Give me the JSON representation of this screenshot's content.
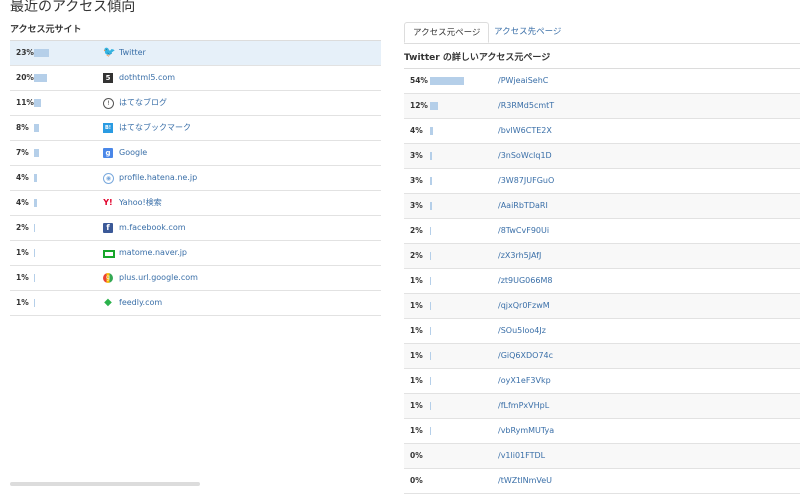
{
  "page_title": "最近のアクセス傾向",
  "sites_section": {
    "heading": "アクセス元サイト",
    "rows": [
      {
        "pct": "23%",
        "value": 23,
        "icon": "twitter-icon",
        "glyph": "🐦",
        "label": "Twitter",
        "highlight": true
      },
      {
        "pct": "20%",
        "value": 20,
        "icon": "dothtml5-icon",
        "glyph": "5",
        "label": "dothtml5.com"
      },
      {
        "pct": "11%",
        "value": 11,
        "icon": "hatena-blog-icon",
        "glyph": "!",
        "label": "はてなブログ"
      },
      {
        "pct": "8%",
        "value": 8,
        "icon": "hatena-bookmark-icon",
        "glyph": "B!",
        "label": "はてなブックマーク"
      },
      {
        "pct": "7%",
        "value": 7,
        "icon": "google-icon",
        "glyph": "g",
        "label": "Google"
      },
      {
        "pct": "4%",
        "value": 4,
        "icon": "hatena-profile-icon",
        "glyph": "◉",
        "label": "profile.hatena.ne.jp"
      },
      {
        "pct": "4%",
        "value": 4,
        "icon": "yahoo-icon",
        "glyph": "Y!",
        "label": "Yahoo!検索"
      },
      {
        "pct": "2%",
        "value": 2,
        "icon": "facebook-icon",
        "glyph": "f",
        "label": "m.facebook.com"
      },
      {
        "pct": "1%",
        "value": 1,
        "icon": "matome-naver-icon",
        "glyph": "",
        "label": "matome.naver.jp"
      },
      {
        "pct": "1%",
        "value": 1,
        "icon": "google-url-icon",
        "glyph": "g",
        "label": "plus.url.google.com"
      },
      {
        "pct": "1%",
        "value": 1,
        "icon": "feedly-icon",
        "glyph": "◆",
        "label": "feedly.com"
      }
    ]
  },
  "tabs": [
    {
      "label": "アクセス元ページ",
      "active": true
    },
    {
      "label": "アクセス先ページ",
      "active": false
    }
  ],
  "pages_section": {
    "heading": "Twitter の詳しいアクセス元ページ",
    "rows": [
      {
        "pct": "54%",
        "value": 54,
        "label": "/PWjeaiSehC"
      },
      {
        "pct": "12%",
        "value": 12,
        "label": "/R3RMd5cmtT"
      },
      {
        "pct": "4%",
        "value": 4,
        "label": "/bvlW6CTE2X"
      },
      {
        "pct": "3%",
        "value": 3,
        "label": "/3nSoWclq1D"
      },
      {
        "pct": "3%",
        "value": 3,
        "label": "/3W87JUFGuO"
      },
      {
        "pct": "3%",
        "value": 3,
        "label": "/AaiRbTDaRI"
      },
      {
        "pct": "2%",
        "value": 2,
        "label": "/8TwCvF90Ui"
      },
      {
        "pct": "2%",
        "value": 2,
        "label": "/zX3rh5JAfJ"
      },
      {
        "pct": "1%",
        "value": 1,
        "label": "/zt9UG066M8"
      },
      {
        "pct": "1%",
        "value": 1,
        "label": "/qjxQr0FzwM"
      },
      {
        "pct": "1%",
        "value": 1,
        "label": "/SOu5loo4Jz"
      },
      {
        "pct": "1%",
        "value": 1,
        "label": "/GiQ6XDO74c"
      },
      {
        "pct": "1%",
        "value": 1,
        "label": "/oyX1eF3Vkp"
      },
      {
        "pct": "1%",
        "value": 1,
        "label": "/fLfmPxVHpL"
      },
      {
        "pct": "1%",
        "value": 1,
        "label": "/vbRymMUTya"
      },
      {
        "pct": "0%",
        "value": 0,
        "label": "/v1li01FTDL"
      },
      {
        "pct": "0%",
        "value": 0,
        "label": "/tWZtlNmVeU"
      }
    ]
  },
  "colors": {
    "bar": "#b5cfe9",
    "link": "#3a6fa8",
    "highlight": "#e6f0f9"
  }
}
